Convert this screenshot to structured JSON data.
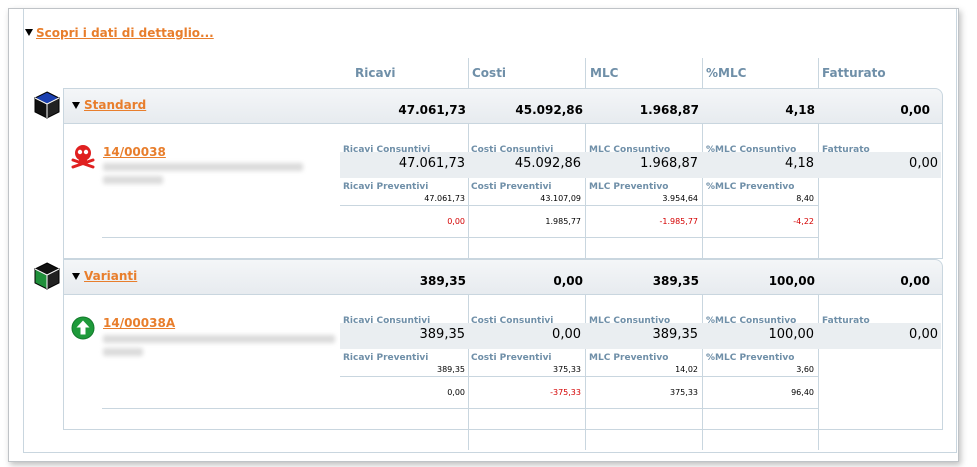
{
  "header": {
    "details_link": "Scopri i dati di dettaglio..."
  },
  "columns": [
    "Ricavi",
    "Costi",
    "MLC",
    "%MLC",
    "Fatturato"
  ],
  "groups": [
    {
      "name": "Standard",
      "totals": [
        "47.061,73",
        "45.092,86",
        "1.968,87",
        "4,18",
        "0,00"
      ],
      "item": {
        "code": "14/00038",
        "consuntivi_labels": [
          "Ricavi Consuntivi",
          "Costi Consuntivi",
          "MLC Consuntivo",
          "%MLC Consuntivo",
          "Fatturato"
        ],
        "consuntivi_values": [
          "47.061,73",
          "45.092,86",
          "1.968,87",
          "4,18",
          "0,00"
        ],
        "preventivi_labels": [
          "Ricavi Preventivi",
          "Costi Preventivi",
          "MLC Preventivo",
          "%MLC Preventivo"
        ],
        "preventivi_values": [
          "47.061,73",
          "43.107,09",
          "3.954,64",
          "8,40"
        ],
        "diff_values": [
          "0,00",
          "1.985,77",
          "-1.985,77",
          "-4,22"
        ]
      }
    },
    {
      "name": "Varianti",
      "totals": [
        "389,35",
        "0,00",
        "389,35",
        "100,00",
        "0,00"
      ],
      "item": {
        "code": "14/00038A",
        "consuntivi_labels": [
          "Ricavi Consuntivi",
          "Costi Consuntivi",
          "MLC Consuntivo",
          "%MLC Consuntivo",
          "Fatturato"
        ],
        "consuntivi_values": [
          "389,35",
          "0,00",
          "389,35",
          "100,00",
          "0,00"
        ],
        "preventivi_labels": [
          "Ricavi Preventivi",
          "Costi Preventivi",
          "MLC Preventivo",
          "%MLC Preventivo"
        ],
        "preventivi_values": [
          "389,35",
          "375,33",
          "14,02",
          "3,60"
        ],
        "diff_values": [
          "0,00",
          "-375,33",
          "375,33",
          "96,40"
        ]
      }
    }
  ],
  "colors": {
    "link": "#e87e2c",
    "header_text": "#6f8fa8",
    "negative": "#d40000",
    "border": "#c9d6df"
  }
}
